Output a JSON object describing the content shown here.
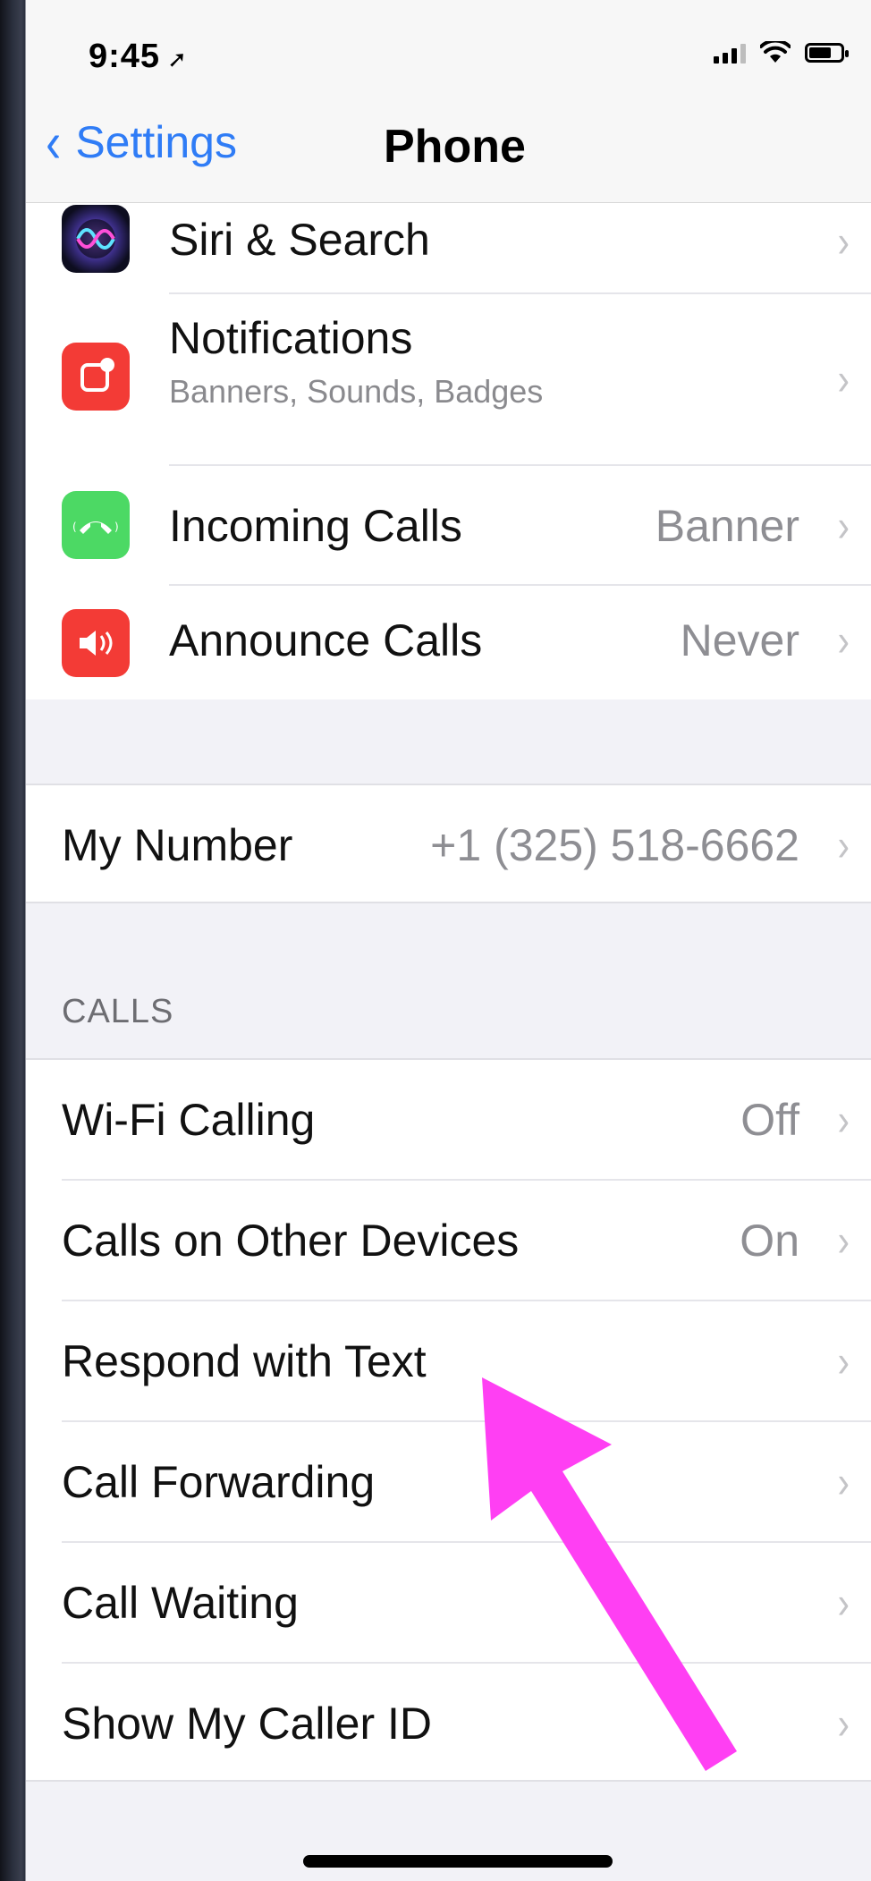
{
  "status_bar": {
    "time": "9:45",
    "location_icon": "location-arrow-icon",
    "icons": [
      "cellular-signal-icon",
      "wifi-icon",
      "battery-icon"
    ]
  },
  "nav": {
    "back_label": "Settings",
    "title": "Phone"
  },
  "group1": [
    {
      "label": "Siri & Search",
      "icon": "siri-icon",
      "value": ""
    },
    {
      "label": "Notifications",
      "sub": "Banners, Sounds, Badges",
      "icon": "notifications-icon",
      "value": ""
    },
    {
      "label": "Incoming Calls",
      "icon": "phone-icon",
      "value": "Banner"
    },
    {
      "label": "Announce Calls",
      "icon": "speaker-icon",
      "value": "Never"
    }
  ],
  "my_number": {
    "label": "My Number",
    "value": "+1 (325) 518-6662"
  },
  "calls_section": {
    "header": "CALLS",
    "items": [
      {
        "label": "Wi-Fi Calling",
        "value": "Off"
      },
      {
        "label": "Calls on Other Devices",
        "value": "On"
      },
      {
        "label": "Respond with Text",
        "value": ""
      },
      {
        "label": "Call Forwarding",
        "value": ""
      },
      {
        "label": "Call Waiting",
        "value": ""
      },
      {
        "label": "Show My Caller ID",
        "value": ""
      }
    ]
  },
  "colors": {
    "accent": "#2f7cf6",
    "annotation_arrow": "#ff3ff3"
  }
}
